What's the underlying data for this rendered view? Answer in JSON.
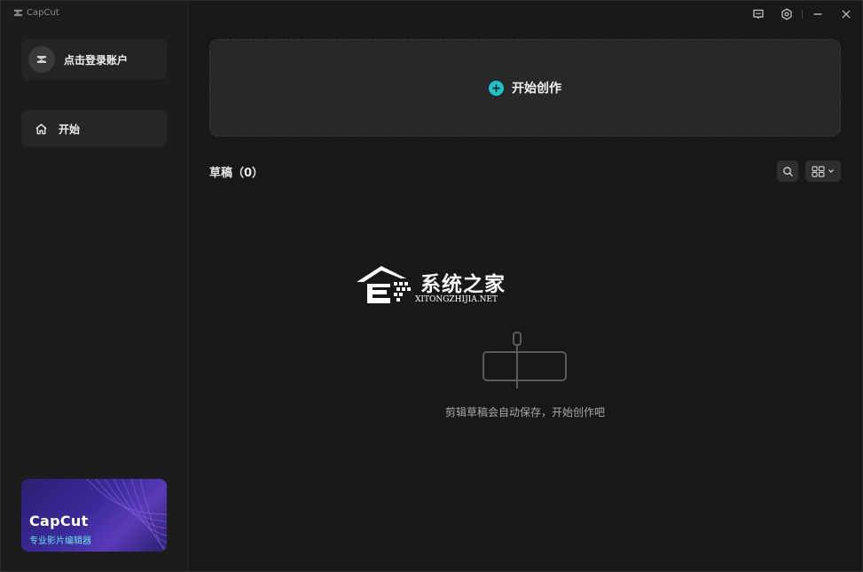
{
  "app": {
    "brand_name": "CapCut"
  },
  "sidebar": {
    "login_label": "点击登录账户",
    "nav_items": [
      {
        "label": "开始",
        "icon": "home-icon"
      }
    ],
    "promo": {
      "title": "CapCut",
      "subtitle": "专业影片编辑器"
    }
  },
  "titlebar": {
    "buttons": [
      "feedback-icon",
      "settings-icon",
      "minimize-icon",
      "close-icon"
    ]
  },
  "main": {
    "create_label": "开始创作",
    "drafts_label": "草稿（0）",
    "empty_text": "剪辑草稿会自动保存，开始创作吧"
  },
  "watermark": {
    "title": "系统之家",
    "subtitle": "XITONGZHIJIA.NET"
  },
  "colors": {
    "accent": "#1ec3c9",
    "background": "#181818",
    "sidebar": "#1c1c1c"
  }
}
